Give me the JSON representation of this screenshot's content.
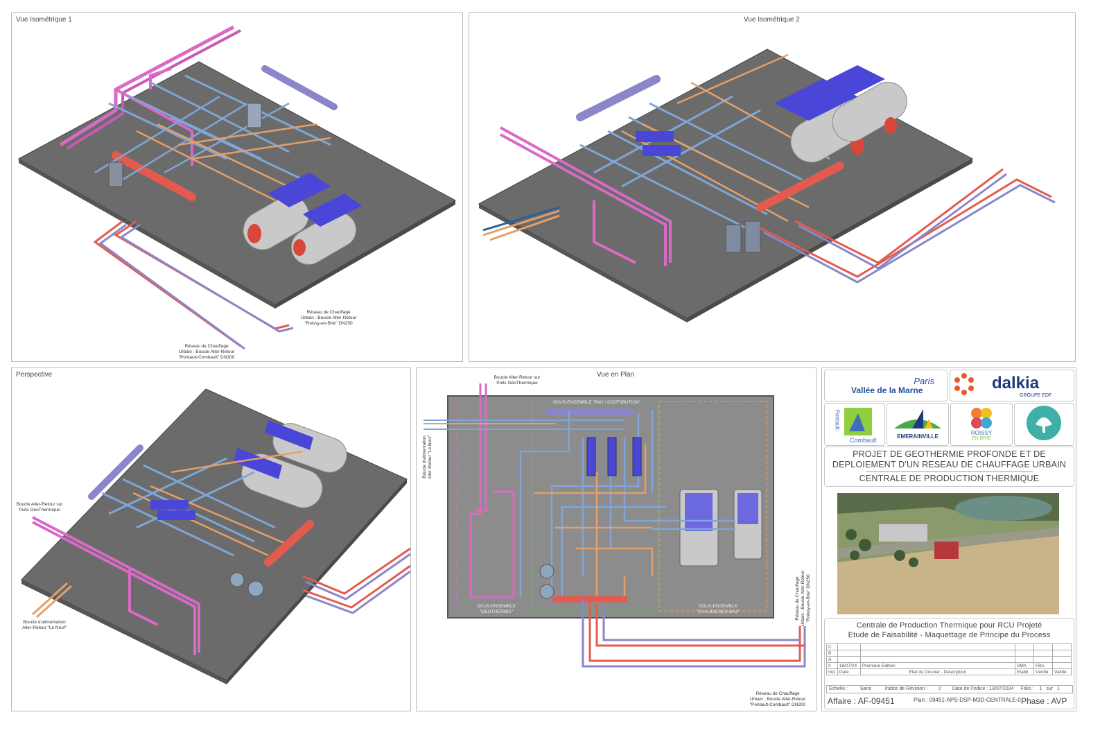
{
  "panels": {
    "iso1": {
      "title": "Vue Isométrique 1"
    },
    "iso2": {
      "title": "Vue Isométrique 2"
    },
    "perspective": {
      "title": "Perspective"
    },
    "plan": {
      "title": "Vue en Plan"
    }
  },
  "annotations": {
    "iso1_network_1": [
      "Réseau de Chauffage",
      "Urbain : Boucle Aller-Retour",
      "\"Roissy-en-Brie\" DN250"
    ],
    "iso1_network_2": [
      "Réseau de Chauffage",
      "Urbain : Boucle Aller-Retour",
      "\"Pontault-Combault\" DN300"
    ],
    "persp_geo": [
      "Boucle Aller-Retour sur",
      "Puits GéoThermique"
    ],
    "persp_feed": [
      "Boucle d'alimentation",
      "Aller-Retour \"Le Neuf\""
    ],
    "plan_geo": [
      "Boucle Aller-Retour sur",
      "Puits GéoThermique"
    ],
    "plan_feed": [
      "Boucle d'alimentation",
      "Aller-Retour \"Le Neuf\""
    ],
    "plan_roissy": [
      "Réseau de Chauffage",
      "Urbain : Boucle Aller-Retour",
      "\"Roissy-en-Brie\" DN250"
    ],
    "plan_pontault": [
      "Réseau de Chauffage",
      "Urbain : Boucle Aller-Retour",
      "\"Pontault-Combault\" DN300"
    ],
    "zone_pac": "SOUS-ENSEMBLE \"PAC / DISTRIBUTION\"",
    "zone_geo": [
      "SOUS-ENSEMBLE",
      "\"GEOTHERMIE\""
    ],
    "zone_gaz": [
      "SOUS-ENSEMBLE",
      "\"CHAUDIERES GAZ\""
    ]
  },
  "logos": {
    "pvm_top": "Paris",
    "pvm_bottom": "Vallée de la Marne",
    "dalkia": "dalkia",
    "dalkia_group": "GROUPE EDF",
    "pontault_a": "Pontault-",
    "pontault_b": "Combault",
    "emerainville": "EMERAINVILLE",
    "roissy_a": "ROISSY",
    "roissy_b": "EN BRIE"
  },
  "project": {
    "line1": "PROJET DE GEOTHERMIE PROFONDE ET DE",
    "line2": "DEPLOIEMENT D'UN RESEAU DE CHAUFFAGE URBAIN",
    "line3": "CENTRALE DE PRODUCTION THERMIQUE"
  },
  "title_block": {
    "line1": "Centrale de Production Thermique pour RCU Projeté",
    "line2": "Etude de Faisabilité - Maquettage de Principe du Process",
    "revisions": [
      {
        "ind": "C",
        "date": "",
        "desc": "",
        "etab": "",
        "verif": "",
        "valid": ""
      },
      {
        "ind": "B",
        "date": "",
        "desc": "",
        "etab": "",
        "verif": "",
        "valid": ""
      },
      {
        "ind": "A",
        "date": "",
        "desc": "",
        "etab": "",
        "verif": "",
        "valid": ""
      },
      {
        "ind": "0",
        "date": "18/07/24",
        "desc": "Première Edition",
        "etab": "SMA",
        "verif": "FBA",
        "valid": ""
      }
    ],
    "header": {
      "ind": "Ind.",
      "date": "Date",
      "desc": "Etat du Dossier - Description",
      "etab": "Etabli",
      "verif": "Vérifié",
      "valid": "Validé"
    },
    "echelle_label": "Echelle :",
    "echelle": "Sans",
    "indice_label": "Indice de Révision :",
    "indice": "0",
    "date_label": "Date de l'indice :",
    "date": "18/07/2024",
    "folio_label": "Folio :",
    "folio": "1",
    "folio_sep": "sur",
    "folio_total": "1",
    "affaire": "Affaire : AF-09451",
    "plan": "Plan : 09451-APS-DSP-M3D-CENTRALE-0",
    "phase": "Phase : AVP"
  },
  "colors": {
    "floor": "#6a6a6a",
    "pink": "#d96ac6",
    "red": "#e35b4e",
    "blue": "#7fa6d6",
    "orange": "#e3a06a",
    "purple": "#8a86c9",
    "tank": "#c9c9c9",
    "tank_top": "#4a46d8"
  }
}
